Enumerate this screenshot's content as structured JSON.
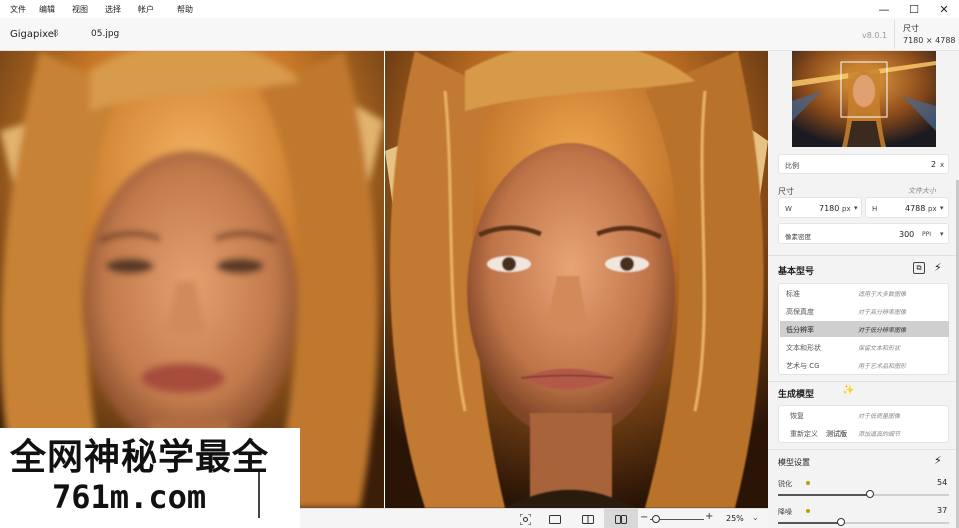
{
  "menu": [
    "文件",
    "编辑",
    "视图",
    "选择",
    "帐户",
    "帮助"
  ],
  "window_controls": [
    "—",
    "☐",
    "✕"
  ],
  "title": {
    "app": "Gigapixel",
    "app_version": "8",
    "file": "05.jpg",
    "version": "v8.0.1"
  },
  "size_header": {
    "label": "尺寸",
    "value": "7180 × 4788"
  },
  "watermark": {
    "line1": "全网神秘学最全",
    "line2": "761m.com"
  },
  "bottom_toolbar": {
    "zoom": "25%",
    "icons": [
      "focus-icon",
      "single-view-icon",
      "split-view-icon",
      "side-by-side-icon"
    ]
  },
  "panel": {
    "scale": {
      "label": "比例",
      "value": "2",
      "unit": "x"
    },
    "dimensions": {
      "label": "尺寸",
      "link": "文件大小",
      "w_label": "W",
      "w_value": "7180",
      "w_unit": "px",
      "h_label": "H",
      "h_value": "4788",
      "h_unit": "px"
    },
    "density": {
      "label": "像素密度",
      "value": "300",
      "unit": "PPI"
    },
    "base_models": {
      "title": "基本型号",
      "items": [
        {
          "name": "标准",
          "desc": "适用于大多数图像"
        },
        {
          "name": "高保真度",
          "desc": "对于高分辨率图像"
        },
        {
          "name": "低分辨率",
          "desc": "对于低分辨率图像"
        },
        {
          "name": "文本和形状",
          "desc": "保留文本和形状"
        },
        {
          "name": "艺术与 CG",
          "desc": "用于艺术品和图形"
        }
      ],
      "selected_index": 2
    },
    "gen_models": {
      "title": "生成模型",
      "items": [
        {
          "name": "恢复",
          "desc": "对于低质量图像"
        },
        {
          "name": "重新定义",
          "badge": "测试版",
          "desc": "添加逼真的细节"
        }
      ]
    },
    "model_settings": {
      "title": "模型设置",
      "sharpen": {
        "label": "锐化",
        "value": "54",
        "fraction": 0.54
      },
      "denoise": {
        "label": "降噪",
        "value": "37",
        "fraction": 0.37
      }
    }
  }
}
